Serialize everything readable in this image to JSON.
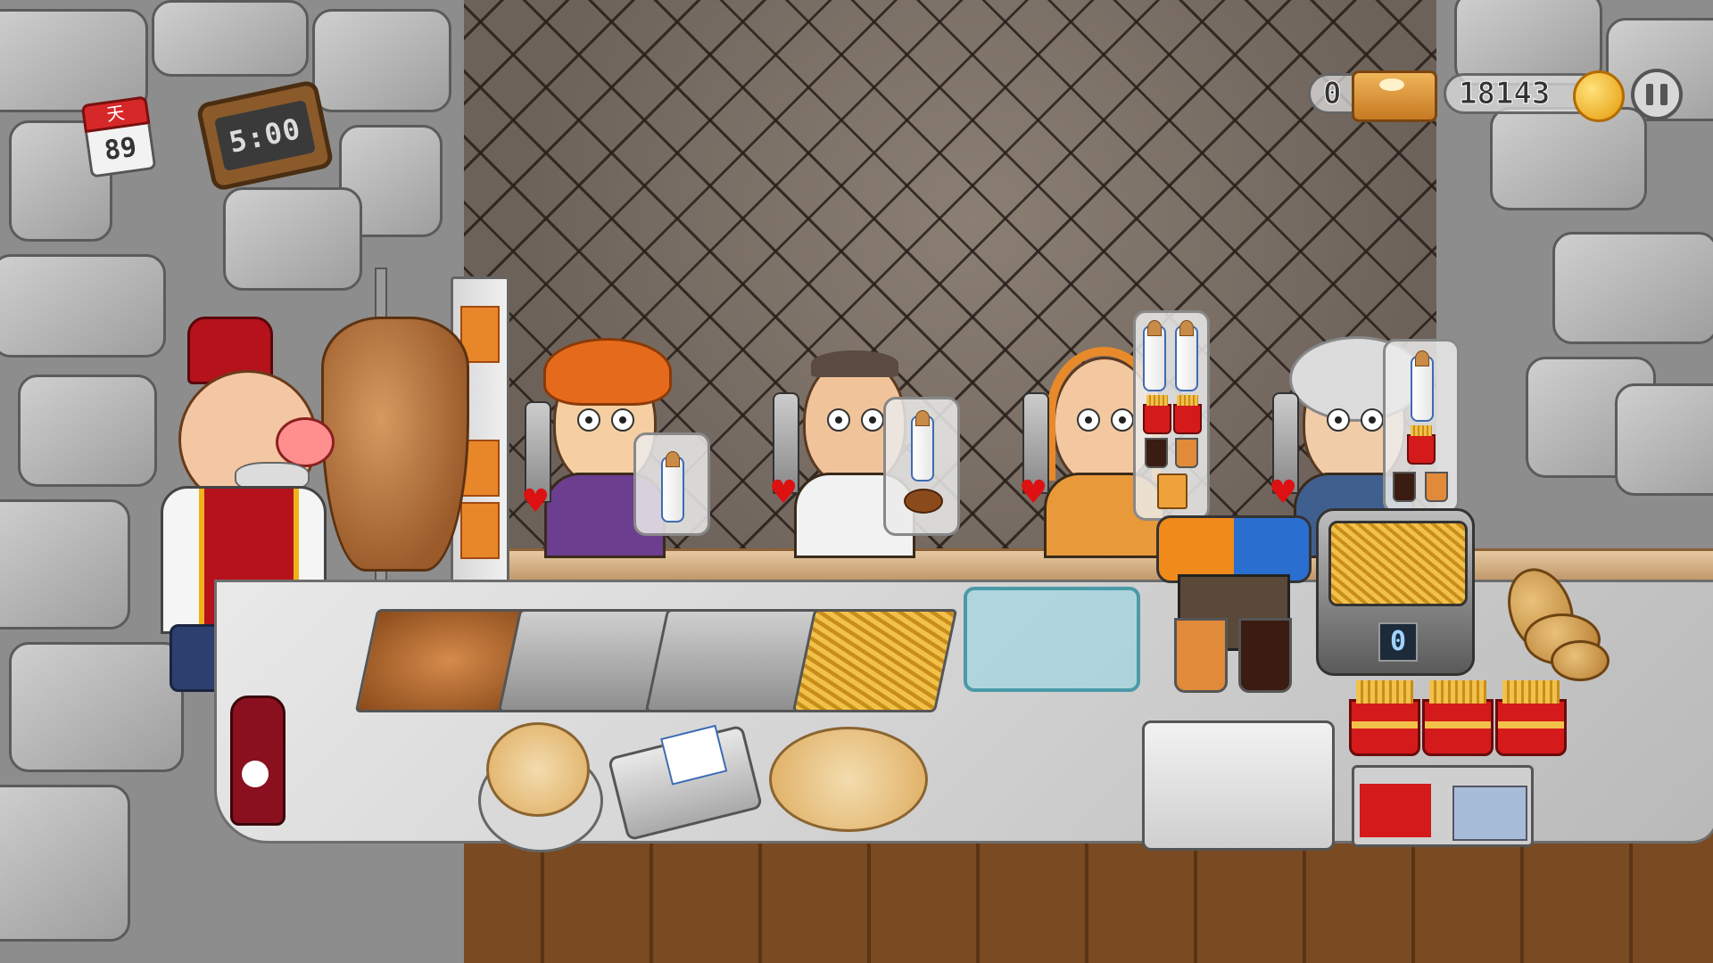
{
  "hud": {
    "calendar_symbol": "天",
    "day": "89",
    "clock_time": "5:00",
    "baklava_count": "0",
    "coins": "18143",
    "pause_icon": "pause-icon"
  },
  "fryer": {
    "display_value": "0"
  },
  "customers": [
    {
      "name": "orange-hair-boy",
      "order_icons": [
        "wrap-icon"
      ],
      "patience": 1.0
    },
    {
      "name": "bald-man",
      "order_icons": [
        "wrap-icon",
        "potato-wedge-icon"
      ],
      "patience": 1.0
    },
    {
      "name": "hijab-woman",
      "order_icons": [
        "wrap-icon",
        "wrap-icon",
        "fries-icon",
        "fries-icon",
        "cola-icon",
        "juice-icon",
        "juice-box-icon"
      ],
      "patience": 1.0
    },
    {
      "name": "grey-hair-grandma",
      "order_icons": [
        "wrap-icon",
        "fries-icon",
        "cola-icon",
        "juice-icon"
      ],
      "patience": 0.7
    }
  ],
  "colors": {
    "coin": "#f0b21a",
    "heart": "#d11111",
    "fries_box": "#d41a1a",
    "cola": "#3a1c12",
    "juice": "#e08a3a"
  }
}
